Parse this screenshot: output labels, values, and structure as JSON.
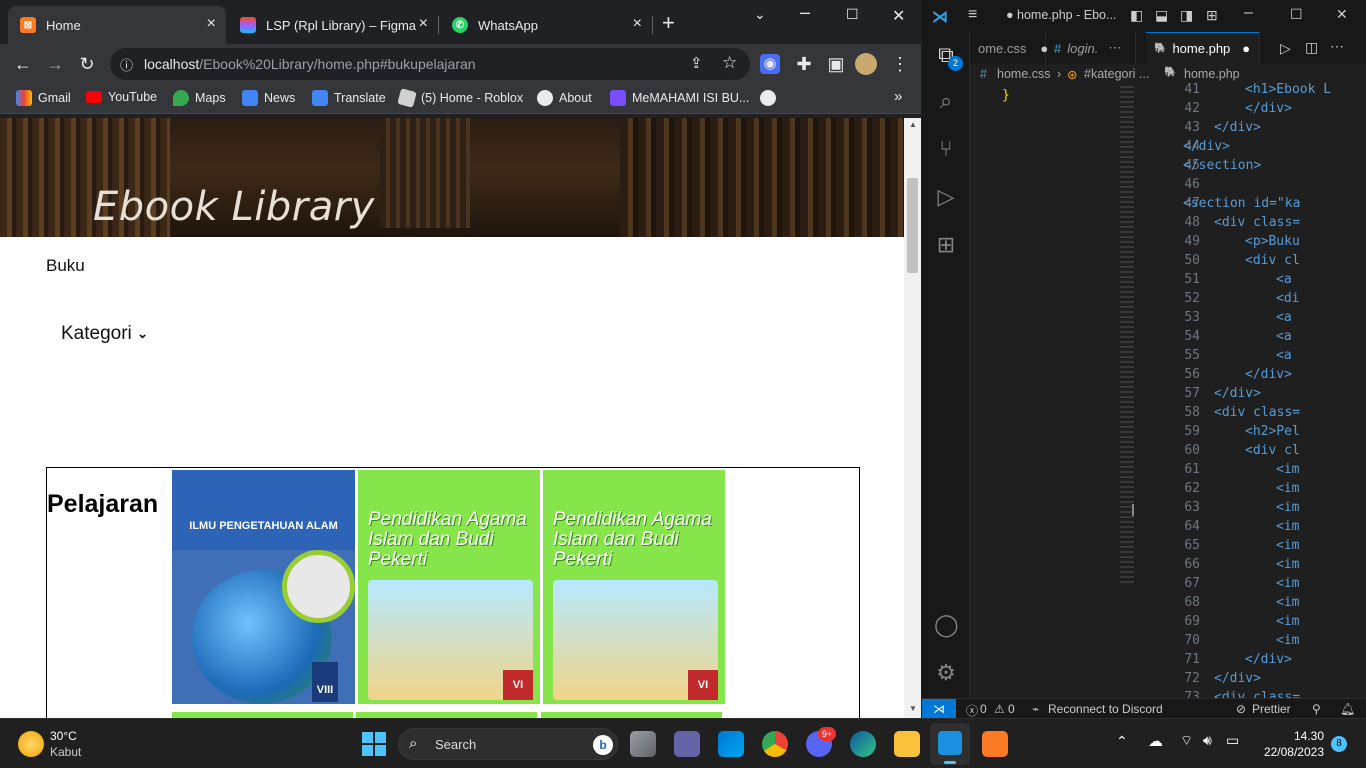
{
  "browser": {
    "tabs": [
      {
        "label": "Home",
        "active": true
      },
      {
        "label": "LSP (Rpl Library) – Figma",
        "active": false
      },
      {
        "label": "WhatsApp",
        "active": false
      }
    ],
    "url_host": "localhost",
    "url_path": "/Ebook%20Library/home.php#bukupelajaran",
    "bookmarks": [
      "Gmail",
      "YouTube",
      "Maps",
      "News",
      "Translate",
      "(5) Home - Roblox",
      "About",
      "MeMAHAMI ISI BU..."
    ],
    "bookmarks_more": "»"
  },
  "page": {
    "hero_title": "Ebook Library",
    "nav_buku": "Buku",
    "kategori": "Kategori",
    "section_title": "Pelajaran",
    "books": [
      {
        "title": "ILMU PENGETAHUAN ALAM",
        "grade": "VIII",
        "color": "#4a7bc8"
      },
      {
        "title": "Pendidikan Agama Islam dan Budi Pekerti",
        "grade": "VI",
        "color": "#7ee83a"
      },
      {
        "title": "Pendidikan Agama Islam dan Budi Pekerti",
        "grade": "VI",
        "color": "#7ee83a"
      }
    ]
  },
  "vscode": {
    "window_title": "● home.php - Ebo...",
    "tabs": [
      {
        "label": "ome.css",
        "dirty": true
      },
      {
        "label": "login.",
        "dirty": false
      },
      {
        "label": "home.php",
        "dirty": true
      }
    ],
    "breadcrumb_left": [
      "home.css",
      "#kategori ..."
    ],
    "breadcrumb_right": "home.php",
    "left_code": "}",
    "lines": [
      {
        "n": "41",
        "code": "<h1>Ebook L"
      },
      {
        "n": "42",
        "code": "</div>"
      },
      {
        "n": "43",
        "code": "</div>"
      },
      {
        "n": "44",
        "code": "</div>"
      },
      {
        "n": "45",
        "code": "</section>"
      },
      {
        "n": "46",
        "code": ""
      },
      {
        "n": "47",
        "code": "<section id=\"ka"
      },
      {
        "n": "48",
        "code": "<div class="
      },
      {
        "n": "49",
        "code": "<p>Buku"
      },
      {
        "n": "50",
        "code": "<div cl"
      },
      {
        "n": "51",
        "code": "<a"
      },
      {
        "n": "52",
        "code": "<di"
      },
      {
        "n": "53",
        "code": "<a"
      },
      {
        "n": "54",
        "code": "<a"
      },
      {
        "n": "55",
        "code": "<a"
      },
      {
        "n": "56",
        "code": "</div>"
      },
      {
        "n": "57",
        "code": "</div>"
      },
      {
        "n": "58",
        "code": "<div class="
      },
      {
        "n": "59",
        "code": "<h2>Pel"
      },
      {
        "n": "60",
        "code": "<div cl"
      },
      {
        "n": "61",
        "code": "<im"
      },
      {
        "n": "62",
        "code": "<im"
      },
      {
        "n": "63",
        "code": "<im"
      },
      {
        "n": "64",
        "code": "<im"
      },
      {
        "n": "65",
        "code": "<im"
      },
      {
        "n": "66",
        "code": "<im"
      },
      {
        "n": "67",
        "code": "<im"
      },
      {
        "n": "68",
        "code": "<im"
      },
      {
        "n": "69",
        "code": "<im"
      },
      {
        "n": "70",
        "code": "<im"
      },
      {
        "n": "71",
        "code": "</div>"
      },
      {
        "n": "72",
        "code": "</div>"
      },
      {
        "n": "73",
        "code": "<div class="
      }
    ],
    "status_errors": "0",
    "status_warnings": "0",
    "status_discord": "Reconnect to Discord",
    "status_prettier": "Prettier",
    "source_control_badge": "2"
  },
  "taskbar": {
    "weather_temp": "30°C",
    "weather_desc": "Kabut",
    "search_label": "Search",
    "time": "14.30",
    "date": "22/08/2023",
    "notif_count": "8",
    "discord_badge": "9+"
  }
}
